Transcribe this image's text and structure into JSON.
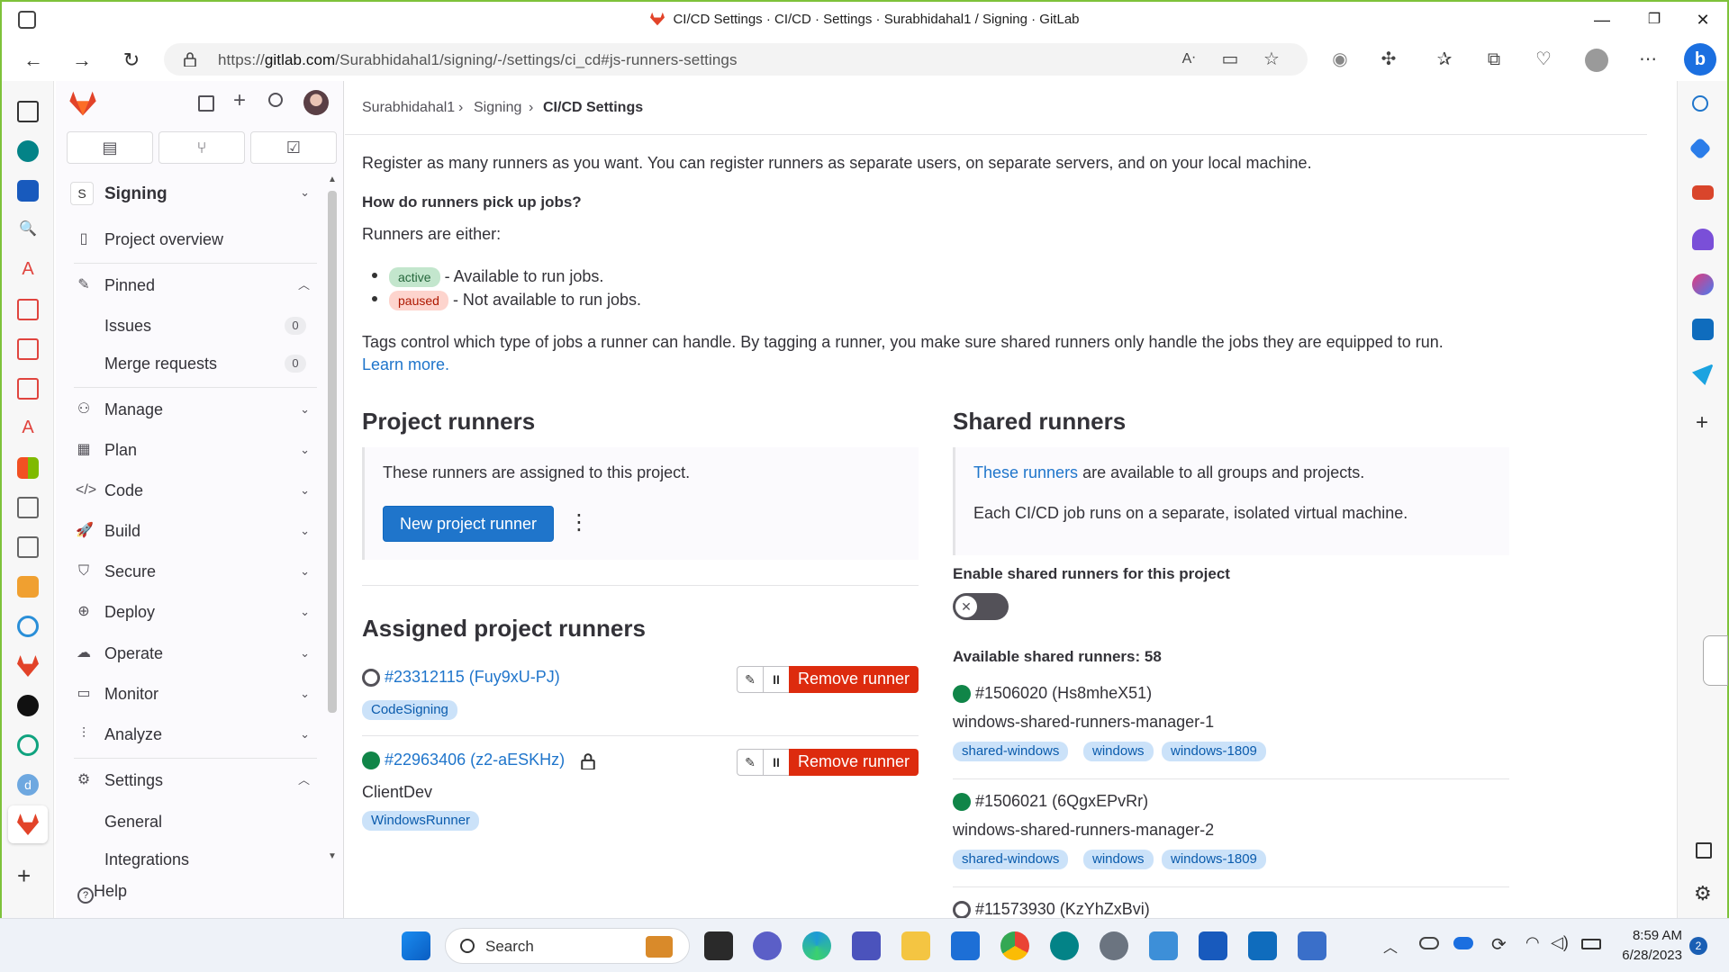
{
  "browser": {
    "window_title": "CI/CD Settings · CI/CD · Settings · Surabhidahal1 / Signing · GitLab",
    "url_prefix": "https://",
    "url_host": "gitlab.com",
    "url_path": "/Surabhidahal1/signing/-/settings/ci_cd#js-runners-settings"
  },
  "sidebar": {
    "project_initial": "S",
    "project_name": "Signing",
    "project_overview": "Project overview",
    "pinned": "Pinned",
    "issues": "Issues",
    "issues_count": "0",
    "merge_requests": "Merge requests",
    "mr_count": "0",
    "items": [
      "Manage",
      "Plan",
      "Code",
      "Build",
      "Secure",
      "Deploy",
      "Operate",
      "Monitor",
      "Analyze"
    ],
    "settings": "Settings",
    "general": "General",
    "integrations": "Integrations",
    "help": "Help"
  },
  "breadcrumb": [
    "Surabhidahal1",
    "Signing",
    "CI/CD Settings"
  ],
  "intro": {
    "register_text": "Register as many runners as you want. You can register runners as separate users, on separate servers, and on your local machine.",
    "how_heading": "How do runners pick up jobs?",
    "either": "Runners are either:",
    "active_badge": "active",
    "active_text": " - Available to run jobs.",
    "paused_badge": "paused",
    "paused_text": " - Not available to run jobs.",
    "tags_text": "Tags control which type of jobs a runner can handle. By tagging a runner, you make sure shared runners only handle the jobs they are equipped to run.",
    "learn_more": "Learn more."
  },
  "project_runners": {
    "heading": "Project runners",
    "description": "These runners are assigned to this project.",
    "new_button": "New project runner",
    "assigned_heading": "Assigned project runners",
    "remove_label": "Remove runner",
    "runners": [
      {
        "id": "#23312115 (Fuy9xU-PJ)",
        "status": "offline",
        "description": "",
        "tag": "CodeSigning",
        "locked": false
      },
      {
        "id": "#22963406 (z2-aESKHz)",
        "status": "online",
        "description": "ClientDev",
        "tag": "WindowsRunner",
        "locked": true
      }
    ]
  },
  "shared_runners": {
    "heading": "Shared runners",
    "link_text": "These runners",
    "desc_rest": " are available to all groups and projects.",
    "desc2": "Each CI/CD job runs on a separate, isolated virtual machine.",
    "enable_label": "Enable shared runners for this project",
    "enabled": false,
    "available_label": "Available shared runners: 58",
    "runners": [
      {
        "id": "#1506020 (Hs8mheX51)",
        "status": "online",
        "name": "windows-shared-runners-manager-1",
        "tags": [
          "shared-windows",
          "windows",
          "windows-1809"
        ]
      },
      {
        "id": "#1506021 (6QgxEPvRr)",
        "status": "online",
        "name": "windows-shared-runners-manager-2",
        "tags": [
          "shared-windows",
          "windows",
          "windows-1809"
        ]
      },
      {
        "id": "#11573930 (KzYhZxBvi)",
        "status": "offline",
        "name": "",
        "tags": []
      }
    ]
  },
  "taskbar": {
    "search_placeholder": "Search",
    "time": "8:59 AM",
    "date": "6/28/2023",
    "notif_count": "2"
  },
  "colors": {
    "gitlab_orange": "#e24329",
    "link_blue": "#1f75cb",
    "danger_red": "#dd2b0e",
    "online_green": "#108548",
    "window_border": "#7ec23a"
  }
}
